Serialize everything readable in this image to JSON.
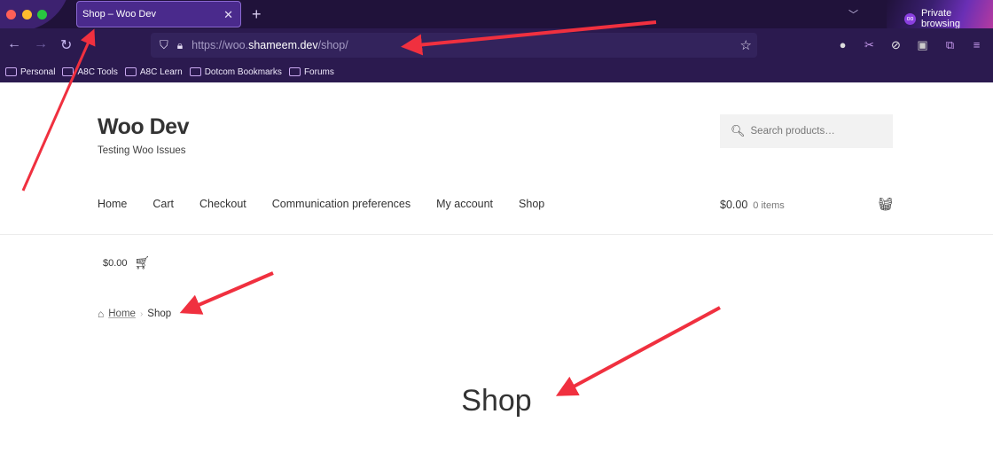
{
  "browser": {
    "tab": {
      "title": "Shop – Woo Dev",
      "close_icon": "close-icon"
    },
    "new_tab_icon": "plus-icon",
    "tabs_dropdown_icon": "chevron-down-icon",
    "private_label": "Private browsing",
    "url": {
      "prefix": "https://woo.",
      "domain": "shameem.dev",
      "path": "/shop/"
    },
    "bookmarks": [
      "Personal",
      "A8C Tools",
      "A8C Learn",
      "Dotcom Bookmarks",
      "Forums"
    ]
  },
  "site": {
    "title": "Woo Dev",
    "tagline": "Testing Woo Issues",
    "search_placeholder": "Search products…",
    "nav": [
      "Home",
      "Cart",
      "Checkout",
      "Communication preferences",
      "My account",
      "Shop"
    ],
    "cart_total": "$0.00",
    "cart_count": "0 items",
    "mini_cart_total": "$0.00"
  },
  "breadcrumb": {
    "home": "Home",
    "current": "Shop"
  },
  "page": {
    "title": "Shop"
  },
  "colors": {
    "chrome_bg": "#2b1a4f",
    "tab_bg": "#4a2a8c",
    "annotation_arrow": "#f0303f"
  }
}
